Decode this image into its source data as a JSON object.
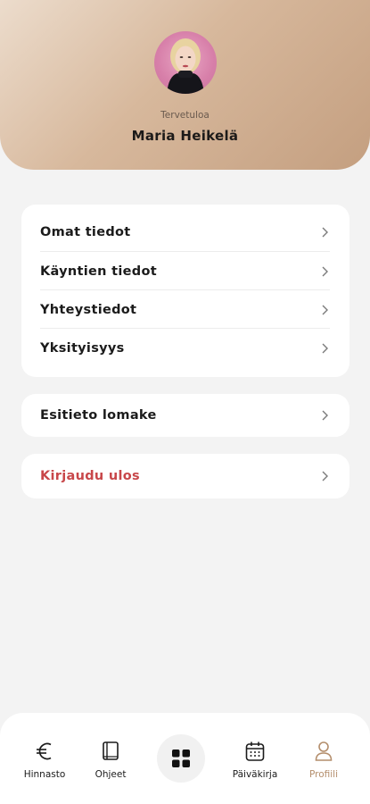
{
  "header": {
    "welcome": "Tervetuloa",
    "user_name": "Maria Heikelä"
  },
  "menu": {
    "group1": [
      {
        "label": "Omat tiedot"
      },
      {
        "label": "Käyntien tiedot"
      },
      {
        "label": "Yhteystiedot"
      },
      {
        "label": "Yksityisyys"
      }
    ],
    "form_label": "Esitieto lomake",
    "logout_label": "Kirjaudu ulos"
  },
  "tabbar": {
    "pricing": "Hinnasto",
    "guides": "Ohjeet",
    "diary": "Päiväkirja",
    "profile": "Profiili"
  },
  "colors": {
    "accent": "#b48e6c",
    "logout": "#c8474a",
    "header_gradient": [
      "#ecdccc",
      "#c49f80"
    ]
  },
  "icons": [
    "euro-icon",
    "book-icon",
    "grid-icon",
    "calendar-icon",
    "user-icon",
    "chevron-right-icon"
  ]
}
